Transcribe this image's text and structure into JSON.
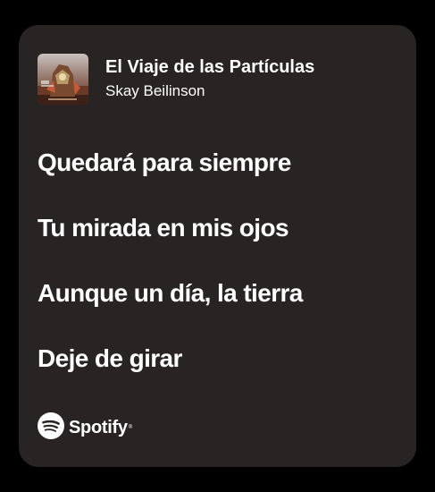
{
  "track": {
    "title": "El Viaje de las Partículas",
    "artist": "Skay Beilinson"
  },
  "lyrics": [
    "Quedará para siempre",
    "Tu mirada en mis ojos",
    "Aunque un día, la tierra",
    "Deje de girar"
  ],
  "brand": {
    "name": "Spotify",
    "trademark": "®"
  },
  "colors": {
    "page_background": "#000000",
    "card_background": "#282423",
    "text": "#ffffff"
  },
  "icons": {
    "brand_logo": "spotify-logo-icon",
    "cover": "album-cover-art"
  }
}
